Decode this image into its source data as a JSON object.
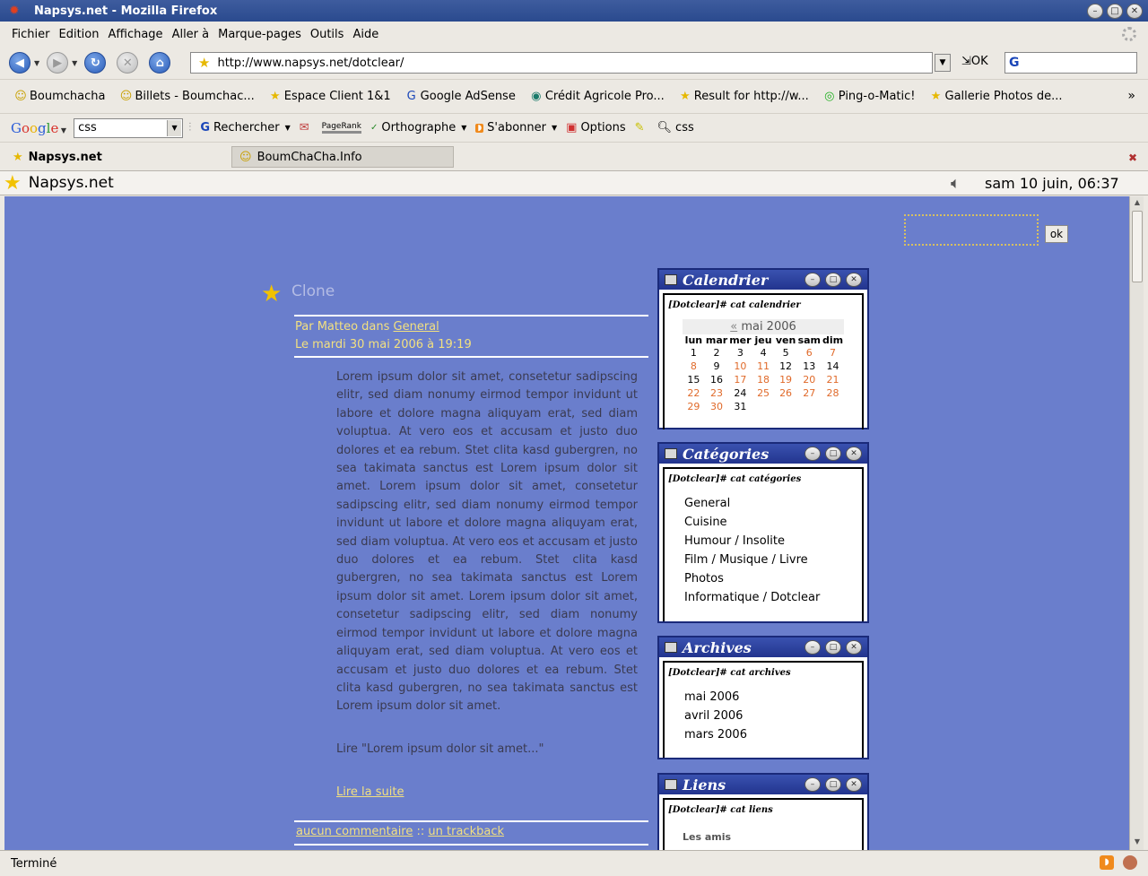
{
  "window": {
    "title": "Napsys.net - Mozilla Firefox"
  },
  "menu": [
    "Fichier",
    "Edition",
    "Affichage",
    "Aller à",
    "Marque-pages",
    "Outils",
    "Aide"
  ],
  "nav": {
    "url": "http://www.napsys.net/dotclear/",
    "ok_label": "OK"
  },
  "bookmarks": [
    "Boumchacha",
    "Billets - Boumchac...",
    "Espace Client 1&1",
    "Google AdSense",
    "Crédit Agricole Pro...",
    "Result for http://w...",
    "Ping-o-Matic!",
    "Gallerie Photos de..."
  ],
  "google_toolbar": {
    "query": "css",
    "search_label": "Rechercher",
    "pagerank_label": "PageRank",
    "spell_label": "Orthographe",
    "subscribe_label": "S'abonner",
    "options_label": "Options",
    "highlight_term": "css"
  },
  "tabs": [
    "Napsys.net",
    "BoumChaCha.Info"
  ],
  "page_header": {
    "site": "Napsys.net",
    "clock": "sam 10 juin, 06:37"
  },
  "site_search": {
    "button": "ok"
  },
  "post": {
    "title": "Clone",
    "author_prefix": "Par Matteo dans ",
    "category": "General",
    "date": "Le mardi 30 mai 2006 à 19:19",
    "body": "Lorem ipsum dolor sit amet, consetetur sadipscing elitr, sed diam nonumy eirmod tempor invidunt ut labore et dolore magna aliquyam erat, sed diam voluptua. At vero eos et accusam et justo duo dolores et ea rebum. Stet clita kasd gubergren, no sea takimata sanctus est Lorem ipsum dolor sit amet. Lorem ipsum dolor sit amet, consetetur sadipscing elitr, sed diam nonumy eirmod tempor invidunt ut labore et dolore magna aliquyam erat, sed diam voluptua. At vero eos et accusam et justo duo dolores et ea rebum. Stet clita kasd gubergren, no sea takimata sanctus est Lorem ipsum dolor sit amet. Lorem ipsum dolor sit amet, consetetur sadipscing elitr, sed diam nonumy eirmod tempor invidunt ut labore et dolore magna aliquyam erat, sed diam voluptua. At vero eos et accusam et justo duo dolores et ea rebum. Stet clita kasd gubergren, no sea takimata sanctus est Lorem ipsum dolor sit amet.",
    "excerpt": "Lire \"Lorem ipsum dolor sit amet...\"",
    "read_more": "Lire la suite",
    "comments": "aucun commentaire",
    "separator": " :: ",
    "trackbacks": "un trackback"
  },
  "widgets": {
    "calendar": {
      "title": "Calendrier",
      "cmd": "[Dotclear]# cat calendrier",
      "prev": "«",
      "month": "mai 2006",
      "days": [
        "lun",
        "mar",
        "mer",
        "jeu",
        "ven",
        "sam",
        "dim"
      ],
      "weeks": [
        [
          "1",
          "2",
          "3",
          "4",
          "5",
          "6",
          "7"
        ],
        [
          "8",
          "9",
          "10",
          "11",
          "12",
          "13",
          "14"
        ],
        [
          "15",
          "16",
          "17",
          "18",
          "19",
          "20",
          "21"
        ],
        [
          "22",
          "23",
          "24",
          "25",
          "26",
          "27",
          "28"
        ],
        [
          "29",
          "30",
          "31",
          "",
          "",
          "",
          ""
        ]
      ]
    },
    "categories": {
      "title": "Catégories",
      "cmd": "[Dotclear]# cat catégories",
      "items": [
        "General",
        "Cuisine",
        "Humour / Insolite",
        "Film / Musique / Livre",
        "Photos",
        "Informatique / Dotclear"
      ]
    },
    "archives": {
      "title": "Archives",
      "cmd": "[Dotclear]# cat archives",
      "items": [
        "mai 2006",
        "avril 2006",
        "mars 2006"
      ]
    },
    "links": {
      "title": "Liens",
      "cmd": "[Dotclear]# cat liens",
      "section": "Les amis"
    }
  },
  "status": {
    "text": "Terminé"
  },
  "colors": {
    "content_bg": "#6a7ecc",
    "link": "#f2e080",
    "weekend": "#e06a2a"
  }
}
